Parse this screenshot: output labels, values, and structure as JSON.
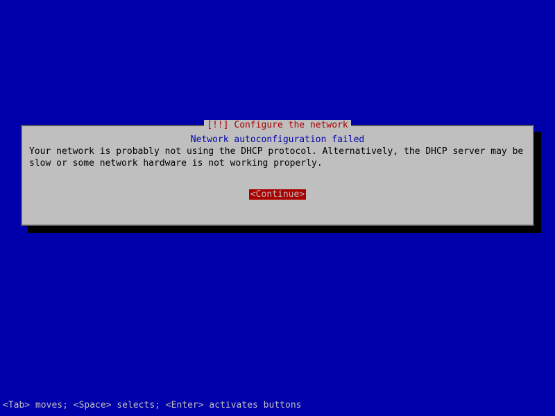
{
  "dialog": {
    "title": "[!!] Configure the network",
    "heading": "Network autoconfiguration failed",
    "body": "Your network is probably not using the DHCP protocol. Alternatively, the DHCP server may be slow or some network hardware is not working properly.",
    "continue_label": "<Continue>"
  },
  "footer": {
    "help_text": "<Tab> moves; <Space> selects; <Enter> activates buttons"
  }
}
